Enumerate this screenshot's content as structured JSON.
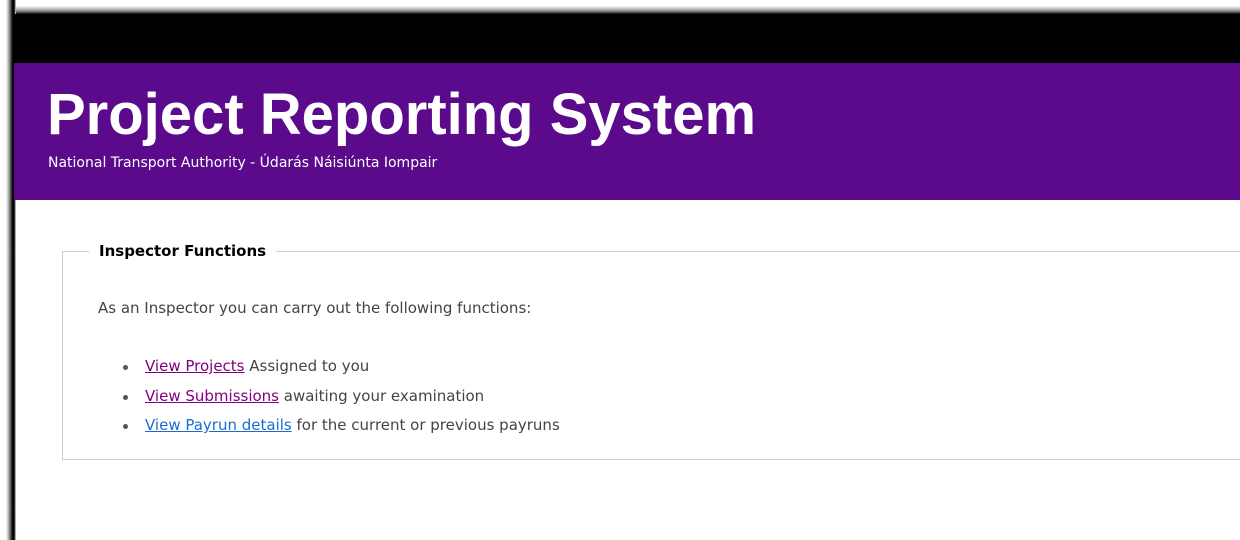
{
  "header": {
    "title": "Project Reporting System",
    "subtitle": "National Transport Authority - Údarás Náisiúnta Iompair"
  },
  "functions": {
    "legend": "Inspector Functions",
    "intro": "As an Inspector you can carry out the following functions:",
    "items": [
      {
        "link_text": "View Projects",
        "rest_text": " Assigned to you",
        "link_state": "visited"
      },
      {
        "link_text": "View Submissions",
        "rest_text": " awaiting your examination",
        "link_state": "visited"
      },
      {
        "link_text": "View Payrun details",
        "rest_text": " for the current or previous payruns",
        "link_state": "unvisited"
      }
    ]
  },
  "colors": {
    "header_bg": "#5b0a8c",
    "top_bar": "#000000",
    "visited_link": "#800080",
    "link": "#1a6bd6"
  }
}
